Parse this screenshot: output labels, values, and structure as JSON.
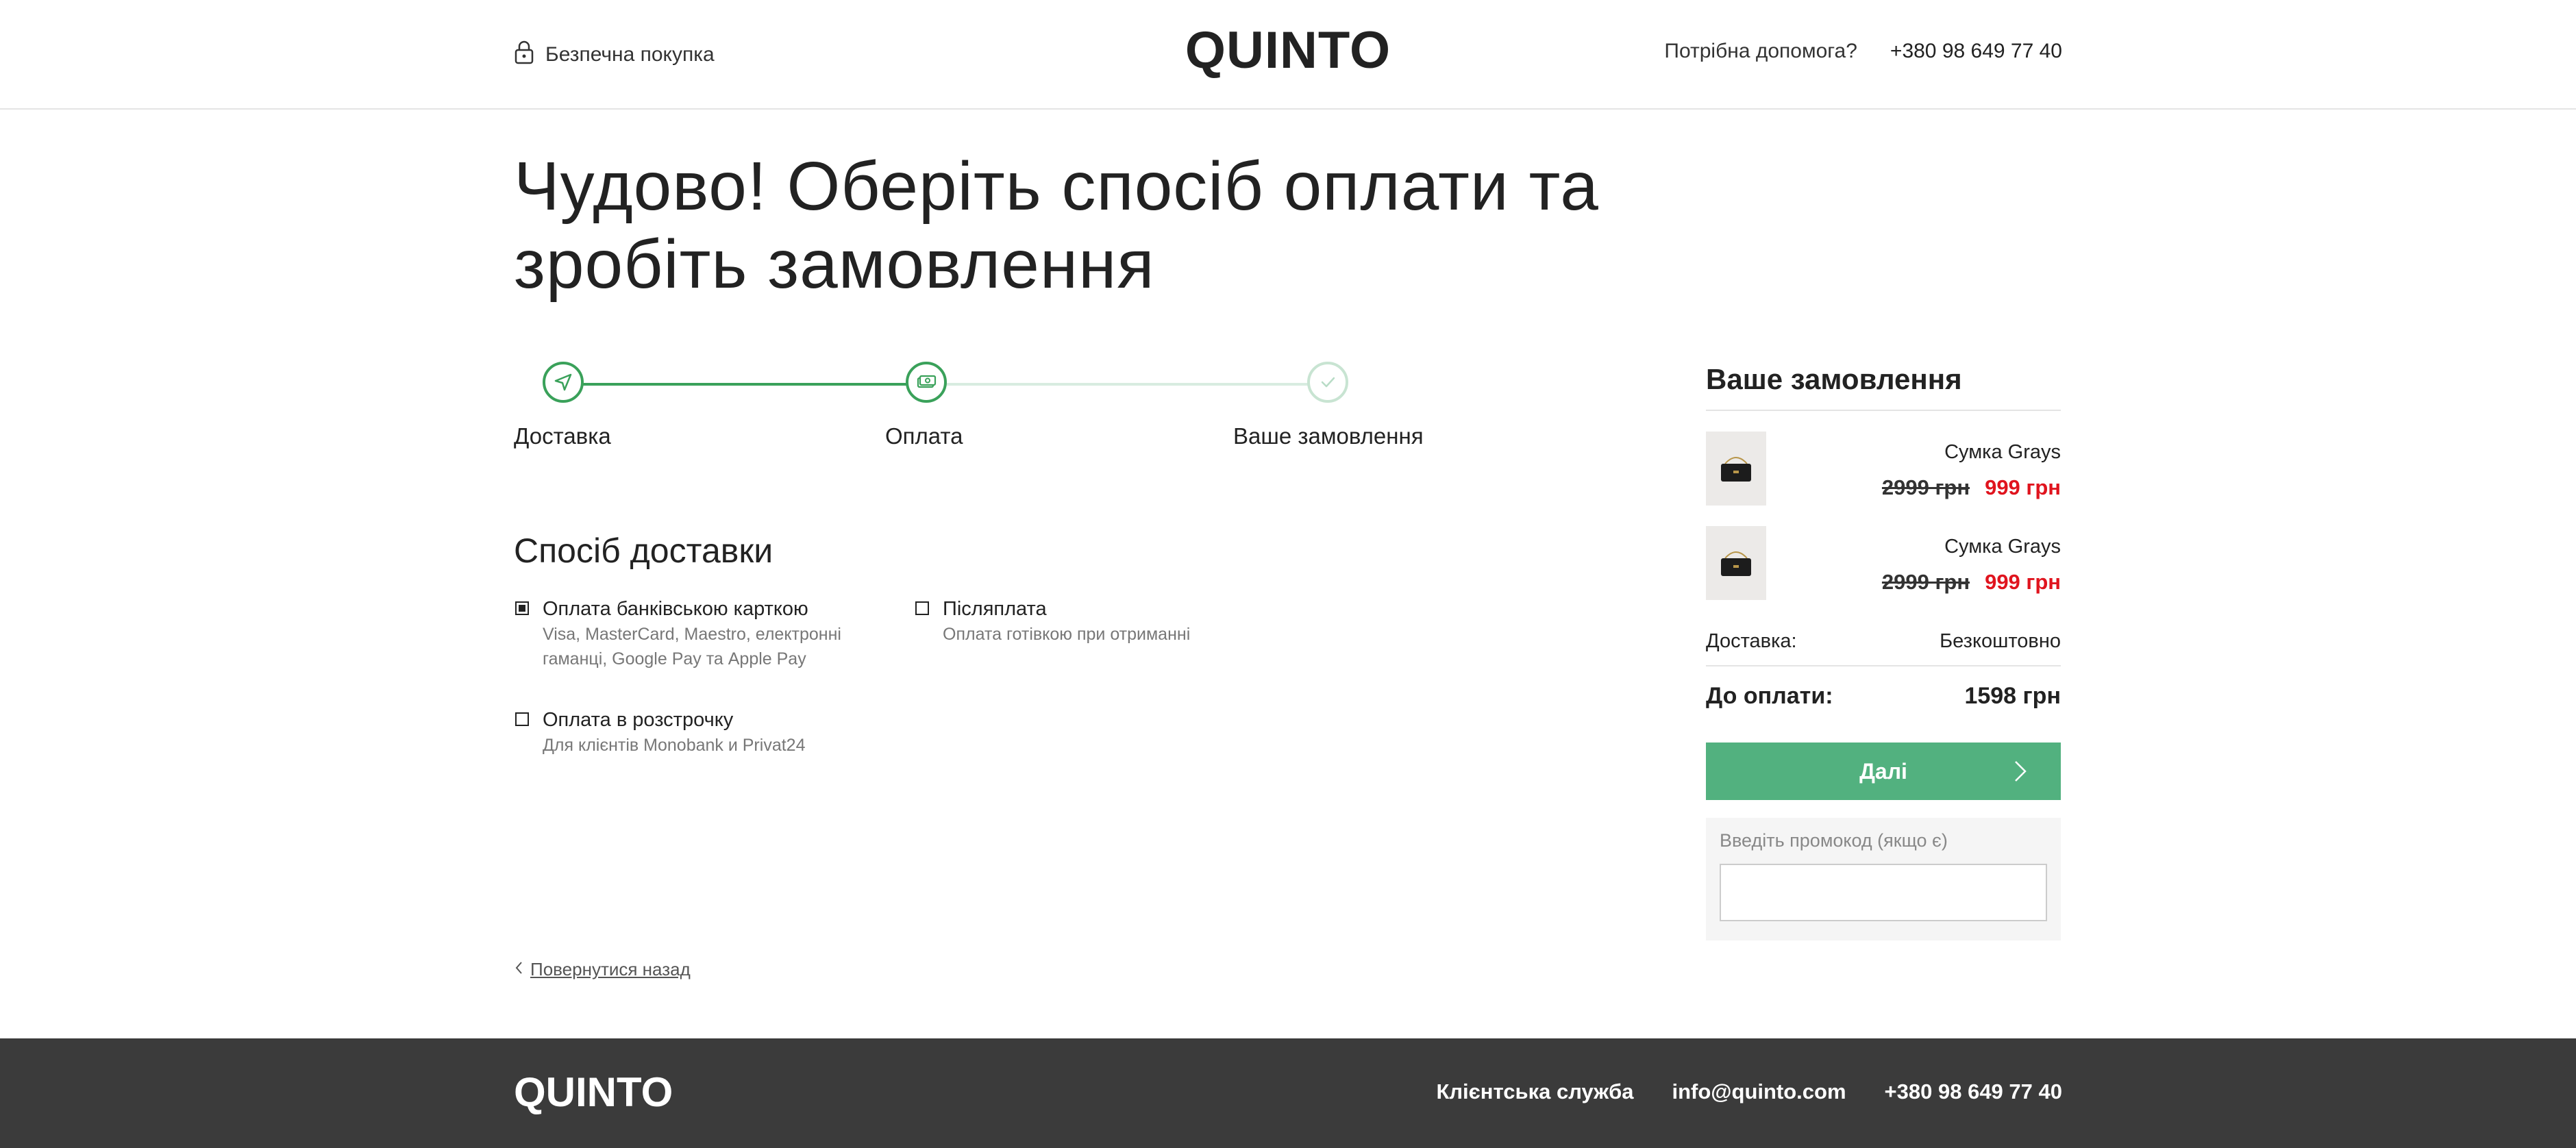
{
  "header": {
    "secure_label": "Безпечна покупка",
    "logo": "QUINTO",
    "help_label": "Потрібна допомога?",
    "phone": "+380 98 649 77 40"
  },
  "page": {
    "title_line1": "Чудово! Оберіть спосіб оплати та",
    "title_line2": "зробіть замовлення"
  },
  "stepper": {
    "steps": [
      {
        "label": "Доставка",
        "state": "done",
        "icon": "send-icon"
      },
      {
        "label": "Оплата",
        "state": "active",
        "icon": "money-icon"
      },
      {
        "label": "Ваше замовлення",
        "state": "inactive",
        "icon": "check-icon"
      }
    ]
  },
  "payment": {
    "section_title": "Спосіб доставки",
    "options": [
      {
        "title": "Оплата банківською карткою",
        "desc": "Visa, MasterCard, Maestro, електронні гаманці, Google Pay та Apple Pay",
        "checked": true
      },
      {
        "title": "Післяплата",
        "desc": "Оплата готівкою при отриманні",
        "checked": false
      },
      {
        "title": "Оплата в розстрочку",
        "desc": "Для клієнтів Monobank и Privat24",
        "checked": false
      }
    ],
    "back_link": "Повернутися назад"
  },
  "summary": {
    "title": "Ваше замовлення",
    "items": [
      {
        "name": "Сумка Grays",
        "old_price": "2999 грн",
        "new_price": "999 грн"
      },
      {
        "name": "Сумка Grays",
        "old_price": "2999 грн",
        "new_price": "999 грн"
      }
    ],
    "delivery_label": "Доставка:",
    "delivery_value": "Безкоштовно",
    "total_label": "До оплати:",
    "total_value": "1598 грн",
    "next_button": "Далі",
    "promo_label": "Введіть промокод (якщо є)",
    "promo_value": ""
  },
  "footer": {
    "logo": "QUINTO",
    "service_label": "Клієнтська служба",
    "email": "info@quinto.com",
    "phone": "+380 98 649 77 40"
  },
  "colors": {
    "accent_green": "#3aa15a",
    "button_green": "#52b17f",
    "sale_red": "#e0141e",
    "footer_bg": "#3b3b3b"
  }
}
